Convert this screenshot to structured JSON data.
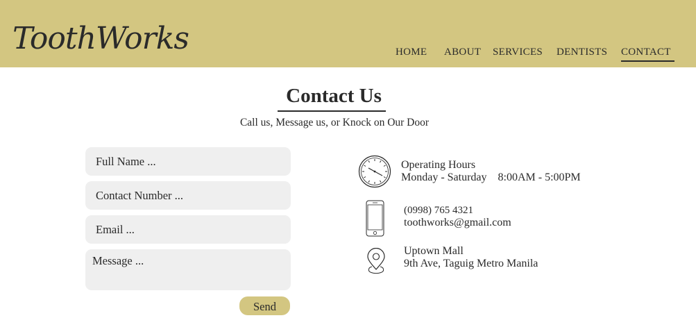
{
  "brand": {
    "logo_text": "ToothWorks"
  },
  "nav": {
    "items": [
      {
        "label": "HOME"
      },
      {
        "label": "ABOUT"
      },
      {
        "label": "SERVICES"
      },
      {
        "label": "DENTISTS"
      },
      {
        "label": "CONTACT",
        "active": true
      }
    ]
  },
  "page": {
    "title": "Contact Us",
    "subtitle": "Call us, Message us, or Knock on Our Door"
  },
  "form": {
    "full_name_placeholder": "Full Name ...",
    "contact_number_placeholder": "Contact Number ...",
    "email_placeholder": "Email ...",
    "message_placeholder": "Message ...",
    "send_label": "Send"
  },
  "info": {
    "hours": {
      "icon": "clock-icon",
      "title": "Operating Hours",
      "detail": "Monday - Saturday    8:00AM - 5:00PM"
    },
    "contact": {
      "icon": "phone-icon",
      "phone": "(0998) 765 4321",
      "email": "toothworks@gmail.com"
    },
    "location": {
      "icon": "location-pin-icon",
      "place": "Uptown Mall",
      "address": "9th Ave, Taguig Metro Manila"
    }
  },
  "colors": {
    "accent": "#d3c681",
    "field_bg": "#efefef",
    "text": "#2a2a2a"
  }
}
